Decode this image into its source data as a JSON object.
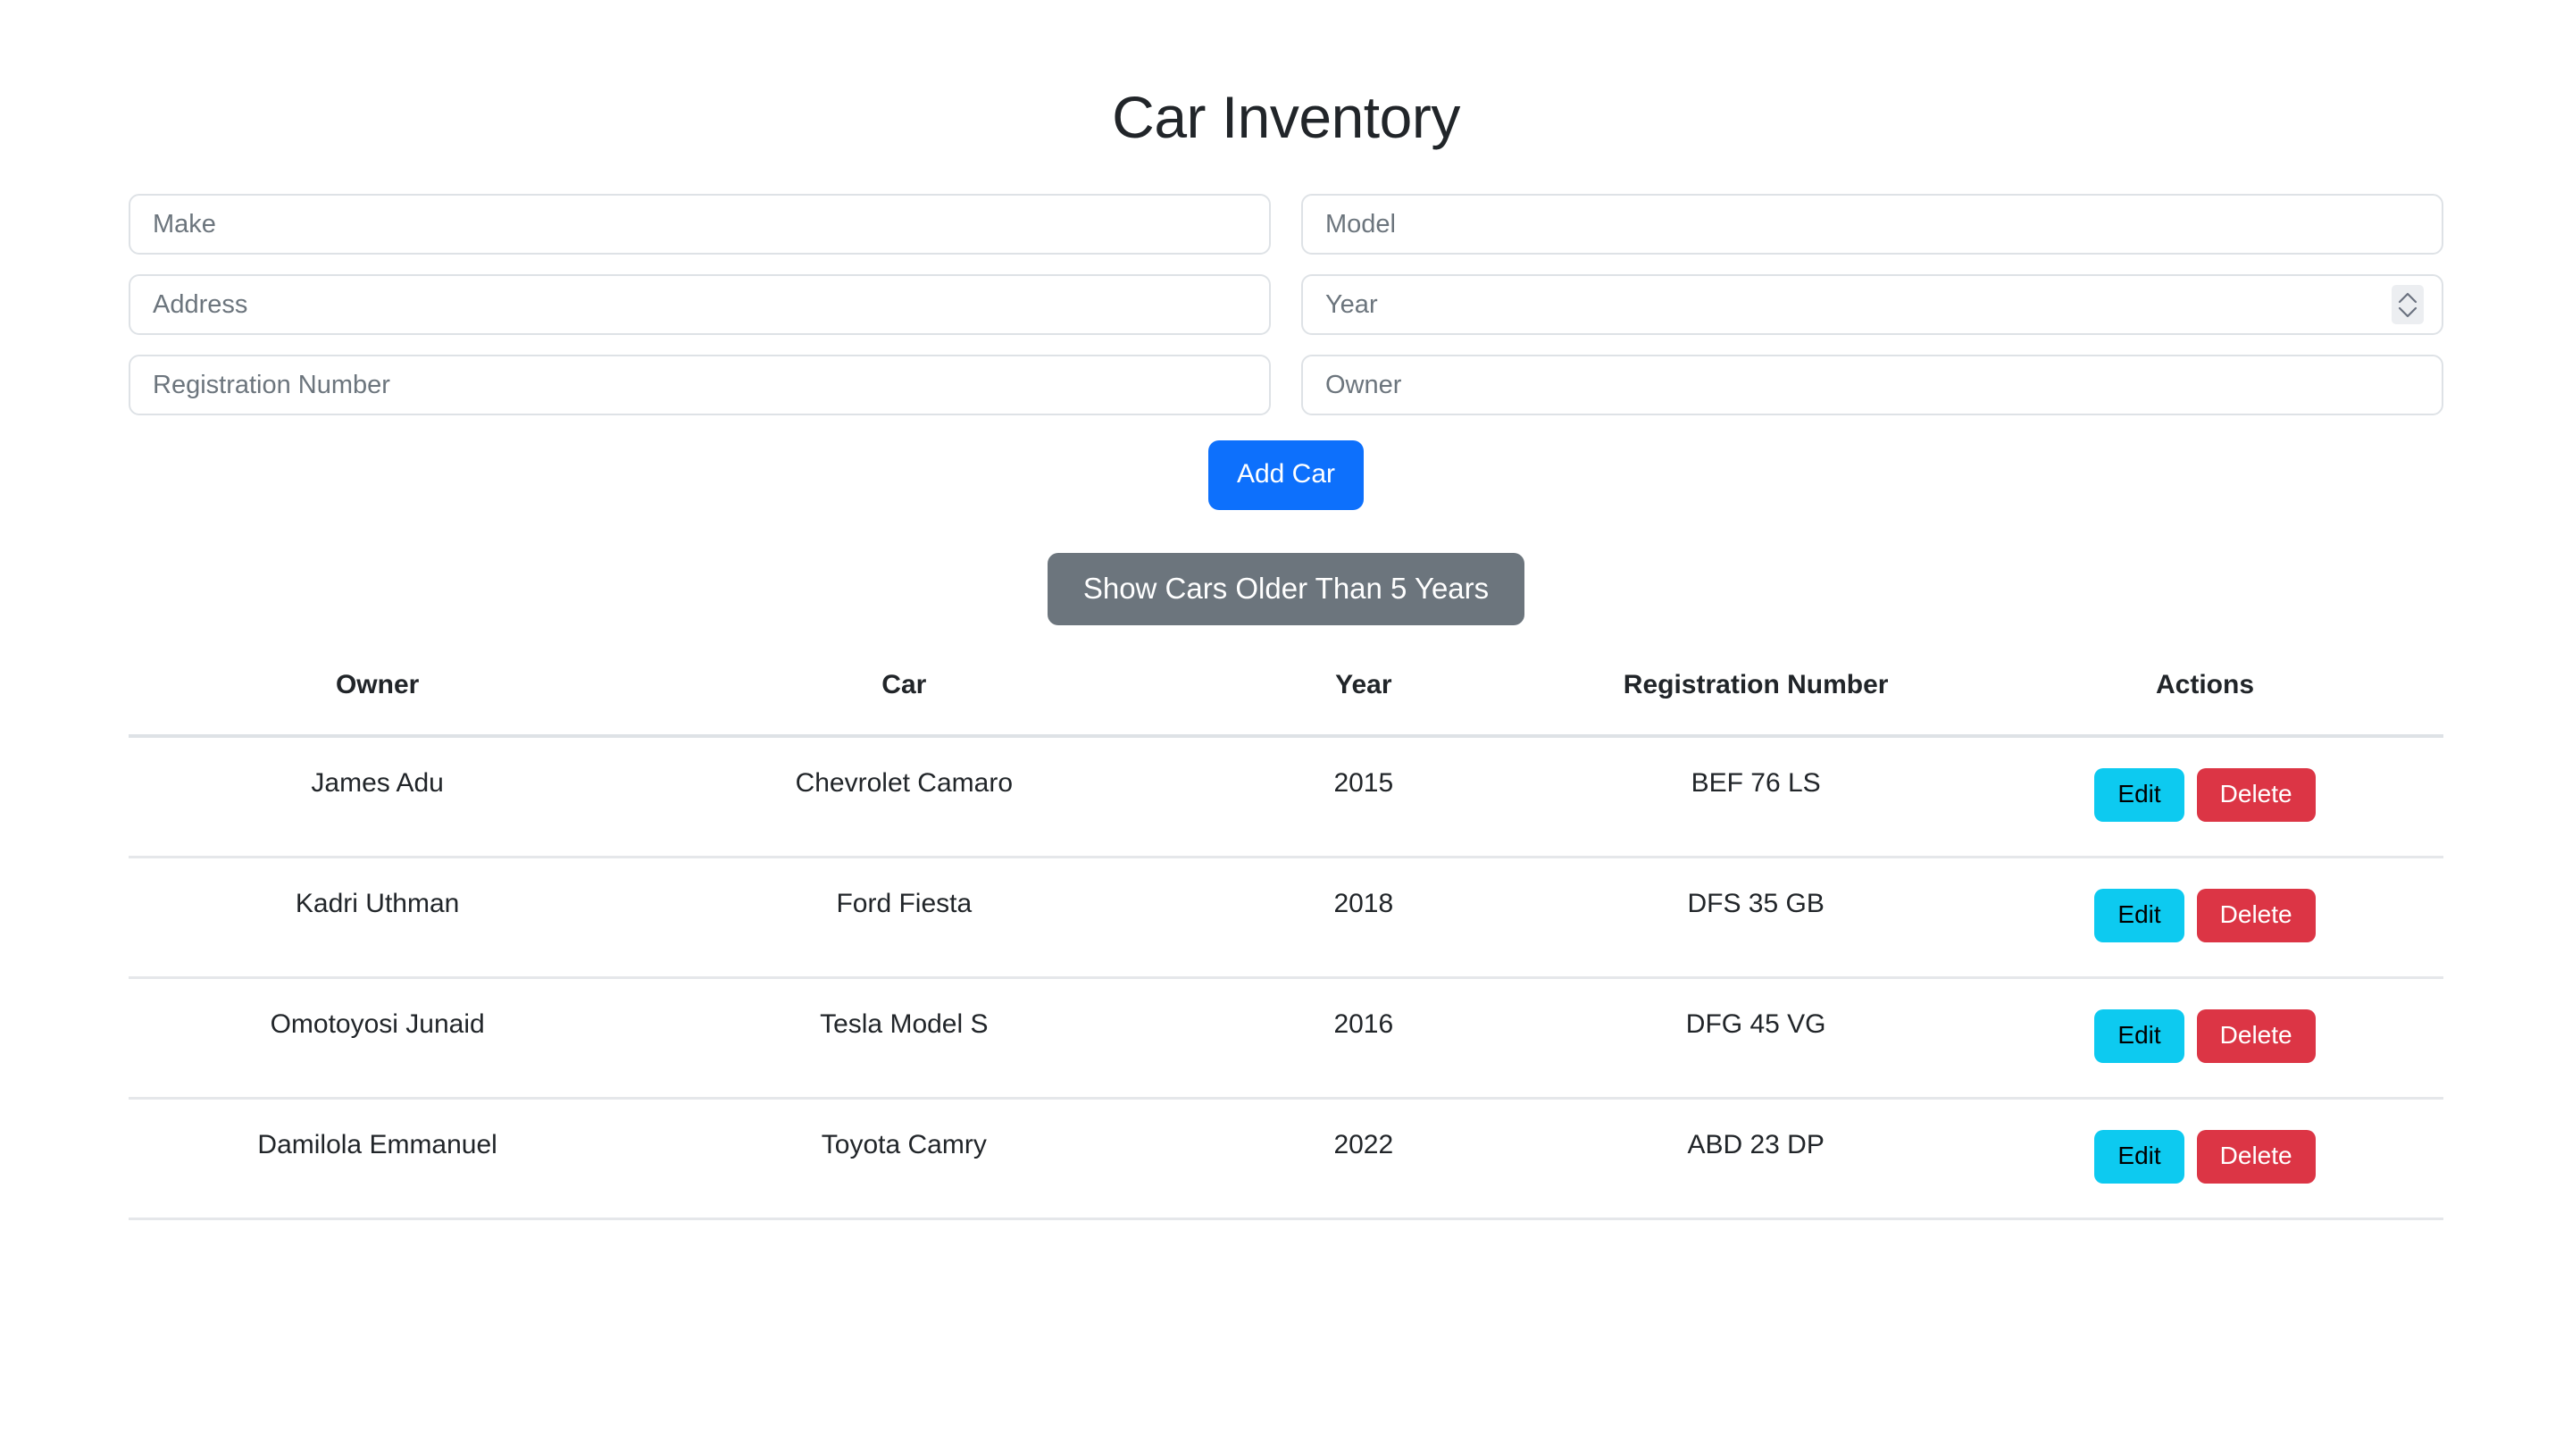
{
  "page": {
    "title": "Car Inventory"
  },
  "form": {
    "fields": [
      {
        "name": "make",
        "placeholder": "Make",
        "value": "",
        "type": "text",
        "spinner": false
      },
      {
        "name": "model",
        "placeholder": "Model",
        "value": "",
        "type": "text",
        "spinner": false
      },
      {
        "name": "address",
        "placeholder": "Address",
        "value": "",
        "type": "text",
        "spinner": false
      },
      {
        "name": "year",
        "placeholder": "Year",
        "value": "",
        "type": "number",
        "spinner": true
      },
      {
        "name": "registration",
        "placeholder": "Registration Number",
        "value": "",
        "type": "text",
        "spinner": false
      },
      {
        "name": "owner",
        "placeholder": "Owner",
        "value": "",
        "type": "text",
        "spinner": false
      }
    ],
    "add_button_label": "Add Car",
    "filter_button_label": "Show Cars Older Than 5 Years"
  },
  "table": {
    "columns": [
      "Owner",
      "Car",
      "Year",
      "Registration Number",
      "Actions"
    ],
    "rows": [
      {
        "owner": "James Adu",
        "car": "Chevrolet Camaro",
        "year": "2015",
        "registration": "BEF 76 LS",
        "edit_label": "Edit",
        "delete_label": "Delete"
      },
      {
        "owner": "Kadri Uthman",
        "car": "Ford Fiesta",
        "year": "2018",
        "registration": "DFS 35 GB",
        "edit_label": "Edit",
        "delete_label": "Delete"
      },
      {
        "owner": "Omotoyosi Junaid",
        "car": "Tesla Model S",
        "year": "2016",
        "registration": "DFG 45 VG",
        "edit_label": "Edit",
        "delete_label": "Delete"
      },
      {
        "owner": "Damilola Emmanuel",
        "car": "Toyota Camry",
        "year": "2022",
        "registration": "ABD 23 DP",
        "edit_label": "Edit",
        "delete_label": "Delete"
      }
    ]
  },
  "colors": {
    "add_button": "#0d70fc",
    "filter_button": "#6c757d",
    "edit_button": "#0dcaf0",
    "delete_button": "#dc3545",
    "text": "#212529",
    "placeholder": "#6c757d",
    "border": "#dee2e6",
    "background": "#ffffff"
  },
  "icons": {
    "spinner_up": "chevron-up-icon",
    "spinner_down": "chevron-down-icon"
  }
}
